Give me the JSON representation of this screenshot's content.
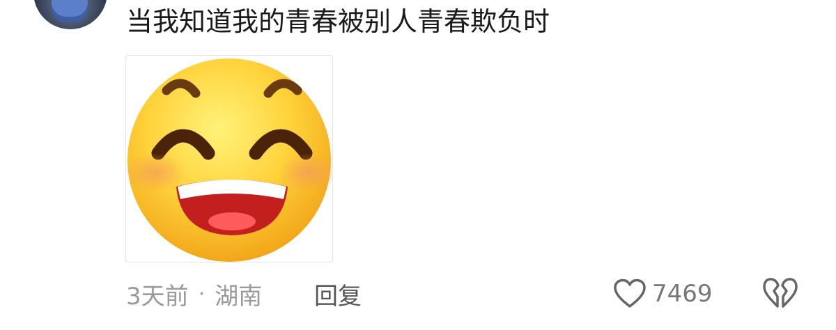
{
  "comment": {
    "text": "当我知道我的青春被别人青春欺负时"
  },
  "footer": {
    "time": "3天前",
    "separator": "·",
    "location": "湖南",
    "reply_label": "回复",
    "like_count": "7469"
  },
  "icons": {
    "like": "heart-icon",
    "dislike": "broken-heart-icon"
  },
  "colors": {
    "text_primary": "#1a1a1a",
    "text_secondary": "#9a9a9a",
    "reply_text": "#555555",
    "icon_stroke": "#666666"
  }
}
